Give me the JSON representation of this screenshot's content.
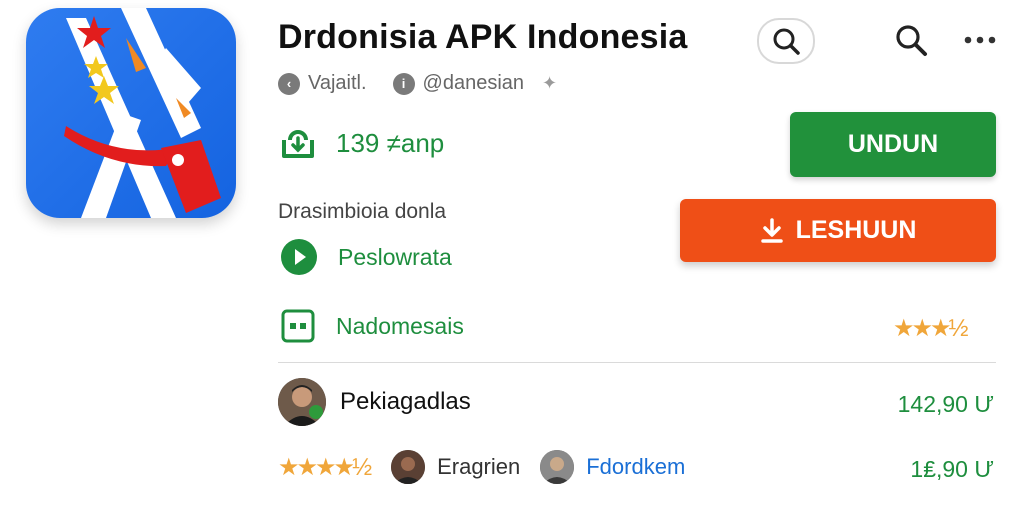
{
  "app": {
    "title": "Drdonisia APK Indonesia",
    "developer": "Vajaitl.",
    "publisher": "@danesian"
  },
  "stats": {
    "downloads": "139 ≠anp"
  },
  "buttons": {
    "primary": "UNDUN",
    "secondary": "LESHUUN"
  },
  "section": {
    "label": "Drasimbioia donla"
  },
  "features": [
    {
      "label": "Peslowrata",
      "icon": "play-icon"
    },
    {
      "label": "Nadomesais",
      "icon": "grid-icon"
    }
  ],
  "ratings": {
    "top": "★★★½",
    "bottom": "★★★★½"
  },
  "reviews": [
    {
      "name": "Pekiagadlas",
      "price": "142,90 Ư"
    },
    {
      "name_a": "Eragrien",
      "name_b": "Fdordkem",
      "price": "1₤,90 Ư"
    }
  ],
  "colors": {
    "green": "#21913b",
    "orange": "#ef4f17",
    "blue": "#1a6fd6",
    "star": "#f0a63a"
  }
}
